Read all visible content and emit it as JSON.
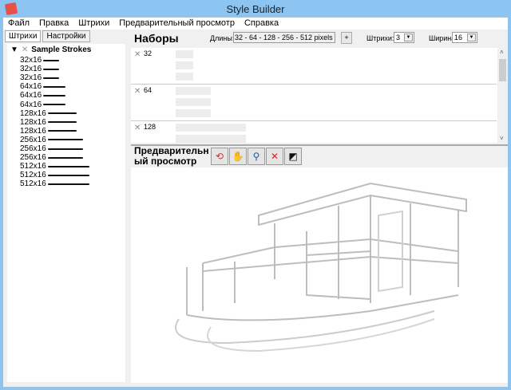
{
  "window": {
    "title": "Style Builder",
    "icon": "app-icon"
  },
  "menu": [
    "Файл",
    "Правка",
    "Штрихи",
    "Предварительный просмотр",
    "Справка"
  ],
  "tabs": [
    "Штрихи",
    "Настройки"
  ],
  "tree": {
    "root": "Sample Strokes",
    "items": [
      {
        "label": "32x16",
        "len": 1
      },
      {
        "label": "32x16",
        "len": 1
      },
      {
        "label": "32x16",
        "len": 1
      },
      {
        "label": "64x16",
        "len": 2
      },
      {
        "label": "64x16",
        "len": 2
      },
      {
        "label": "64x16",
        "len": 2
      },
      {
        "label": "128x16",
        "len": 4
      },
      {
        "label": "128x16",
        "len": 4
      },
      {
        "label": "128x16",
        "len": 4
      },
      {
        "label": "256x16",
        "len": 8
      },
      {
        "label": "256x16",
        "len": 8
      },
      {
        "label": "256x16",
        "len": 8
      },
      {
        "label": "512x16",
        "len": 16
      },
      {
        "label": "512x16",
        "len": 16
      },
      {
        "label": "512x16",
        "len": 16
      }
    ]
  },
  "sets": {
    "title": "Наборы",
    "lengths_label": "Длины:",
    "lengths_value": "32 - 64 - 128 - 256 - 512 pixels",
    "add_label": "+",
    "strokes_label": "Штрихи:",
    "strokes_value": "3",
    "width_label": "Ширина:",
    "width_value": "16",
    "groups": [
      {
        "label": "32",
        "len": 1
      },
      {
        "label": "64",
        "len": 2
      },
      {
        "label": "128",
        "len": 4
      }
    ]
  },
  "preview": {
    "title_line1": "Предварительн",
    "title_line2": "ый просмотр",
    "tools": [
      {
        "name": "refresh-icon",
        "glyph": "⟲",
        "color": "#c33"
      },
      {
        "name": "hand-icon",
        "glyph": "✋",
        "color": "#d9b46a"
      },
      {
        "name": "zoom-icon",
        "glyph": "⚲",
        "color": "#2255aa"
      },
      {
        "name": "zoom-extents-icon",
        "glyph": "✕",
        "color": "#d22"
      },
      {
        "name": "eraser-icon",
        "glyph": "◩",
        "color": "#111"
      }
    ]
  }
}
